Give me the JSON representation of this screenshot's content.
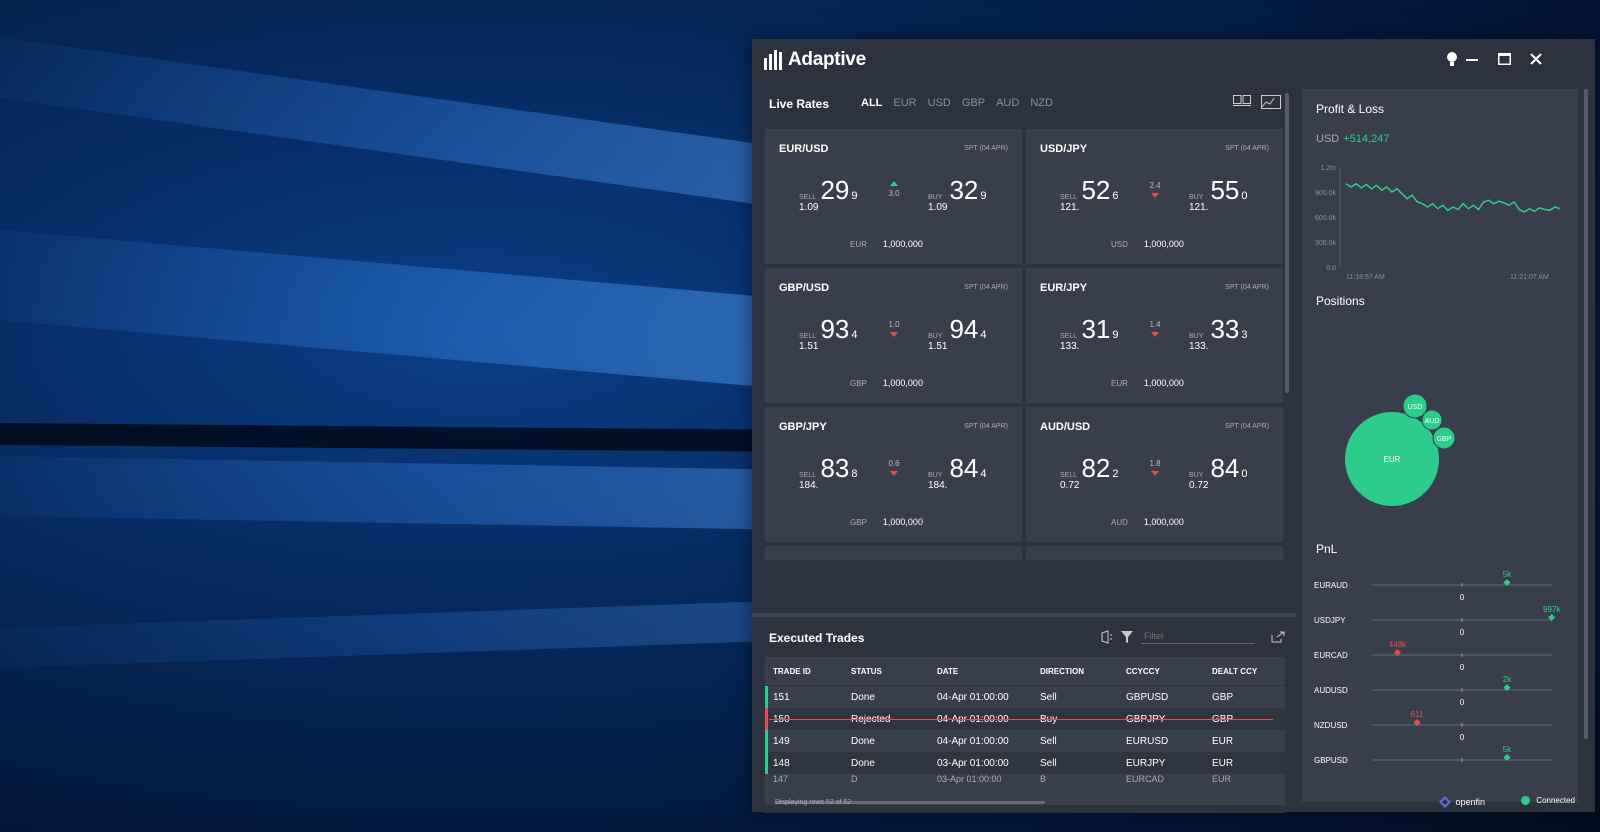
{
  "app": {
    "title": "Adaptive",
    "accent": "#2ecc8c",
    "negative": "#e64c4c"
  },
  "window_controls": {
    "tips_icon": "lightbulb-icon",
    "minimize_icon": "minimize-icon",
    "maximize_icon": "maximize-icon",
    "close_icon": "close-icon"
  },
  "rates": {
    "title": "Live Rates",
    "tabs": [
      "ALL",
      "EUR",
      "USD",
      "GBP",
      "AUD",
      "NZD"
    ],
    "active_tab": "ALL",
    "tiles": [
      {
        "pair": "EUR/USD",
        "spt": "SPT (04 APR)",
        "sell_label": "SELL",
        "sell_big": "1.09",
        "sell_pips": "29",
        "sell_frac": "9",
        "spread": "3.0",
        "direction": "up",
        "buy_label": "BUY",
        "buy_big": "1.09",
        "buy_pips": "32",
        "buy_frac": "9",
        "notional_ccy": "EUR",
        "notional": "1,000,000"
      },
      {
        "pair": "USD/JPY",
        "spt": "SPT (04 APR)",
        "sell_label": "SELL",
        "sell_big": "121.",
        "sell_pips": "52",
        "sell_frac": "6",
        "spread": "2.4",
        "direction": "down",
        "buy_label": "BUY",
        "buy_big": "121.",
        "buy_pips": "55",
        "buy_frac": "0",
        "notional_ccy": "USD",
        "notional": "1,000,000"
      },
      {
        "pair": "GBP/USD",
        "spt": "SPT (04 APR)",
        "sell_label": "SELL",
        "sell_big": "1.51",
        "sell_pips": "93",
        "sell_frac": "4",
        "spread": "1.0",
        "direction": "down",
        "buy_label": "BUY",
        "buy_big": "1.51",
        "buy_pips": "94",
        "buy_frac": "4",
        "notional_ccy": "GBP",
        "notional": "1,000,000"
      },
      {
        "pair": "EUR/JPY",
        "spt": "SPT (04 APR)",
        "sell_label": "SELL",
        "sell_big": "133.",
        "sell_pips": "31",
        "sell_frac": "9",
        "spread": "1.4",
        "direction": "down",
        "buy_label": "BUY",
        "buy_big": "133.",
        "buy_pips": "33",
        "buy_frac": "3",
        "notional_ccy": "EUR",
        "notional": "1,000,000"
      },
      {
        "pair": "GBP/JPY",
        "spt": "SPT (04 APR)",
        "sell_label": "SELL",
        "sell_big": "184.",
        "sell_pips": "83",
        "sell_frac": "8",
        "spread": "0.6",
        "direction": "down",
        "buy_label": "BUY",
        "buy_big": "184.",
        "buy_pips": "84",
        "buy_frac": "4",
        "notional_ccy": "GBP",
        "notional": "1,000,000"
      },
      {
        "pair": "AUD/USD",
        "spt": "SPT (04 APR)",
        "sell_label": "SELL",
        "sell_big": "0.72",
        "sell_pips": "82",
        "sell_frac": "2",
        "spread": "1.8",
        "direction": "down",
        "buy_label": "BUY",
        "buy_big": "0.72",
        "buy_pips": "84",
        "buy_frac": "0",
        "notional_ccy": "AUD",
        "notional": "1,000,000"
      }
    ]
  },
  "trades": {
    "title": "Executed Trades",
    "filter_placeholder": "Filter",
    "columns": [
      "TRADE ID",
      "STATUS",
      "DATE",
      "DIRECTION",
      "CCYCCY",
      "DEALT CCY"
    ],
    "rows": [
      {
        "id": "151",
        "status": "Done",
        "date": "04-Apr 01:00:00",
        "direction": "Sell",
        "ccyccy": "GBPUSD",
        "dealt": "GBP",
        "state": "done"
      },
      {
        "id": "150",
        "status": "Rejected",
        "date": "04-Apr 01:00:00",
        "direction": "Buy",
        "ccyccy": "GBPJPY",
        "dealt": "GBP",
        "state": "rejected"
      },
      {
        "id": "149",
        "status": "Done",
        "date": "04-Apr 01:00:00",
        "direction": "Sell",
        "ccyccy": "EURUSD",
        "dealt": "EUR",
        "state": "done"
      },
      {
        "id": "148",
        "status": "Done",
        "date": "03-Apr 01:00:00",
        "direction": "Sell",
        "ccyccy": "EURJPY",
        "dealt": "EUR",
        "state": "done"
      }
    ],
    "row_count": "Displaying rows 52 of 52"
  },
  "analytics": {
    "pl_title": "Profit & Loss",
    "pl_ccy": "USD",
    "pl_value": "+514,247",
    "pl_chart": {
      "y_ticks": [
        "1.2m",
        "900.0k",
        "600.0k",
        "300.0k",
        "0.0"
      ],
      "x_ticks": [
        "11:18:57 AM",
        "11:21:07 AM"
      ],
      "values": [
        1000,
        960,
        1000,
        950,
        990,
        940,
        980,
        920,
        960,
        900,
        940,
        880,
        820,
        860,
        780,
        760,
        720,
        760,
        700,
        740,
        680,
        720,
        690,
        760,
        700,
        740,
        690,
        780,
        800,
        760,
        790,
        770,
        740,
        780,
        690,
        660,
        700,
        670,
        710,
        690,
        680,
        720,
        700
      ]
    },
    "positions_title": "Positions",
    "positions": [
      {
        "ccy": "EUR"
      },
      {
        "ccy": "USD"
      },
      {
        "ccy": "AUD"
      },
      {
        "ccy": "GBP"
      }
    ],
    "pnl_title": "PnL",
    "pnl_rows": [
      {
        "pair": "EURAUD",
        "label": "5k",
        "value": 5000,
        "zero": "0"
      },
      {
        "pair": "USDJPY",
        "label": "997k",
        "value": 997000,
        "zero": "0"
      },
      {
        "pair": "EURCAD",
        "label": "448k",
        "value": -448000,
        "zero": "0"
      },
      {
        "pair": "AUDUSD",
        "label": "2k",
        "value": 2000,
        "zero": "0"
      },
      {
        "pair": "NZDUSD",
        "label": "611",
        "value": -611,
        "zero": "0"
      },
      {
        "pair": "GBPUSD",
        "label": "5k",
        "value": 5000,
        "zero": ""
      }
    ]
  },
  "footer": {
    "brand": "openfin",
    "status": "Connected",
    "status_color": "#2ecc8c"
  }
}
